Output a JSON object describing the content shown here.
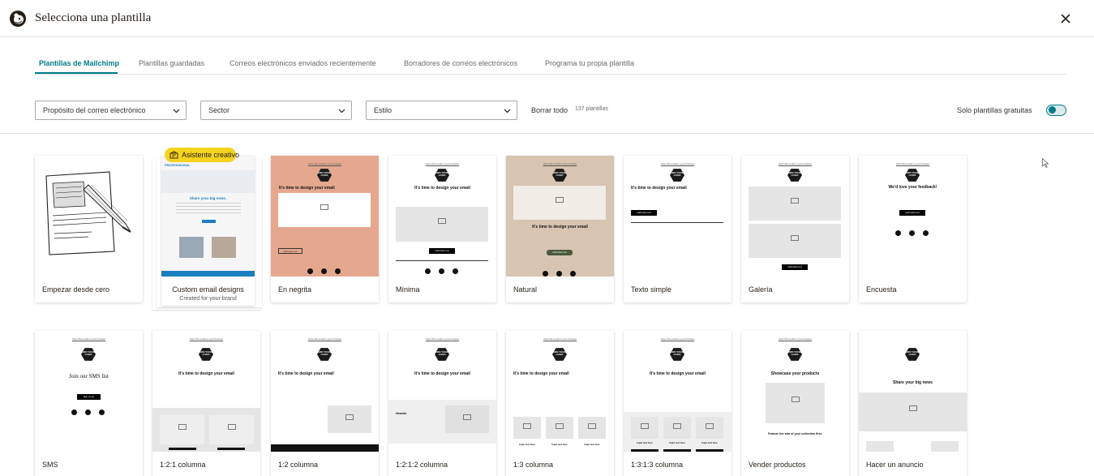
{
  "header": {
    "title": "Selecciona una plantilla"
  },
  "tabs": [
    {
      "label": "Plantillas de Mailchimp"
    },
    {
      "label": "Plantillas guardadas"
    },
    {
      "label": "Correos electrónicos enviados recientemente"
    },
    {
      "label": "Borradores de correos electrónicos"
    },
    {
      "label": "Programa tu propia plantilla"
    }
  ],
  "filters": {
    "purpose": "Propósito del correo electrónico",
    "sector": "Sector",
    "style": "Estilo",
    "clear": "Borrar todo",
    "count": "137 plantillas",
    "free_only": "Solo plantillas gratuitas",
    "free_only_on": true
  },
  "badge": {
    "label": "Asistente creativo"
  },
  "custom": {
    "title": "Custom email designs",
    "subtitle": "Created for your brand",
    "professional": "PROFESSIONAL",
    "share": "Share your big news."
  },
  "templates_row1": [
    {
      "label": "Empezar desde cero"
    },
    {
      "label": "En negrita"
    },
    {
      "label": "Mínima"
    },
    {
      "label": "Natural"
    },
    {
      "label": "Texto simple"
    },
    {
      "label": "Galería"
    },
    {
      "label": "Encuesta"
    }
  ],
  "templates_row2": [
    {
      "label": "SMS"
    },
    {
      "label": "1:2:1 columna"
    },
    {
      "label": "1:2 columna"
    },
    {
      "label": "1:2:1:2 columna"
    },
    {
      "label": "1:3 columna"
    },
    {
      "label": "1:3:1:3 columna"
    },
    {
      "label": "Vender productos"
    },
    {
      "label": "Hacer un anuncio"
    }
  ],
  "thumb_text": {
    "view_browser": "View this email in your browser",
    "logo": "ADD YOUR LOGO",
    "heading": "It's time to design your email",
    "add_photo": "Add your photo",
    "add_button": "Add button text",
    "feedback": "We'd love your feedback!",
    "sms": "Join our SMS list",
    "sign_up": "Sign me up",
    "header": "Header",
    "showcase": "Showcase your products",
    "feature": "Feature the star of your collection first.",
    "big_news": "Share your big news",
    "input_text": "Input text here"
  },
  "colors": {
    "accent": "#007c89",
    "bold_bg": "#e5a88e",
    "natural_bg": "#d7c4b1",
    "natural_button": "#4a5a3d",
    "badge": "#f5d31e"
  }
}
